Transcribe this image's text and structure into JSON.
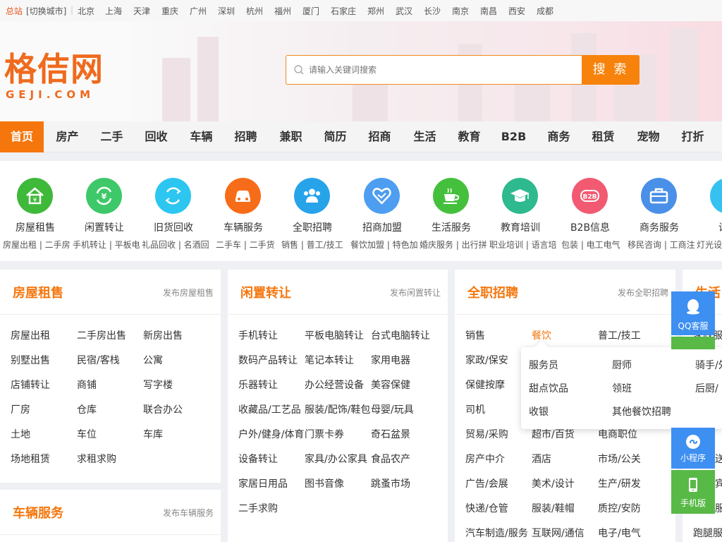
{
  "topbar": {
    "main_site": "总站",
    "switch_city": "[切换城市]",
    "cities": [
      "北京",
      "上海",
      "天津",
      "重庆",
      "广州",
      "深圳",
      "杭州",
      "福州",
      "厦门",
      "石家庄",
      "郑州",
      "武汉",
      "长沙",
      "南京",
      "南昌",
      "西安",
      "成都"
    ]
  },
  "logo": {
    "cn": "格佶网",
    "en": "GEJI.COM"
  },
  "search": {
    "placeholder": "请输入关键词搜索",
    "button": "搜 索"
  },
  "nav": {
    "items": [
      "首页",
      "房产",
      "二手",
      "回收",
      "车辆",
      "招聘",
      "兼职",
      "简历",
      "招商",
      "生活",
      "教育",
      "B2B",
      "商务",
      "租赁",
      "宠物",
      "打折"
    ],
    "active_index": 0
  },
  "categories": [
    {
      "label": "房屋租售",
      "icon": "house-icon",
      "color": "#3fb93a"
    },
    {
      "label": "闲置转让",
      "icon": "exchange-icon",
      "color": "#3ec86a"
    },
    {
      "label": "旧货回收",
      "icon": "recycle-icon",
      "color": "#2cc6f0"
    },
    {
      "label": "车辆服务",
      "icon": "car-icon",
      "color": "#f76c18"
    },
    {
      "label": "全职招聘",
      "icon": "people-icon",
      "color": "#27a3ea"
    },
    {
      "label": "招商加盟",
      "icon": "handshake-icon",
      "color": "#4d9ef0"
    },
    {
      "label": "生活服务",
      "icon": "cup-icon",
      "color": "#45c03d"
    },
    {
      "label": "教育培训",
      "icon": "graduation-cap-icon",
      "color": "#2fb98f"
    },
    {
      "label": "B2B信息",
      "icon": "b2b-icon",
      "color": "#f25a72"
    },
    {
      "label": "商务服务",
      "icon": "briefcase-icon",
      "color": "#4a90e8"
    },
    {
      "label": "设备",
      "icon": "device-icon",
      "color": "#36c2f0"
    }
  ],
  "sublinks": [
    "房屋出租 | 二手房 ",
    "手机转让 | 平板电",
    "礼品回收 | 名酒回",
    "二手车 | 二手货",
    "销售 | 普工/技工",
    "餐饮加盟 | 特色加",
    "婚庆服务 | 出行拼",
    "职业培训 | 语言培",
    "包装 | 电工电气",
    "移民咨询 | 工商注",
    "灯光设"
  ],
  "panels": {
    "house": {
      "title": "房屋租售",
      "publish": "发布房屋租售",
      "links": [
        "房屋出租",
        "二手房出售",
        "新房出售",
        "别墅出售",
        "民宿/客栈",
        "公寓",
        "店铺转让",
        "商铺",
        "写字楼",
        "厂房",
        "仓库",
        "联合办公",
        "土地",
        "车位",
        "车库",
        "场地租赁",
        "求租求购"
      ]
    },
    "car": {
      "title": "车辆服务",
      "publish": "发布车辆服务"
    },
    "idle": {
      "title": "闲置转让",
      "publish": "发布闲置转让",
      "links": [
        "手机转让",
        "平板电脑转让",
        "台式电脑转让",
        "数码产品转让",
        "笔记本转让",
        "家用电器",
        "乐器转让",
        "办公经营设备",
        "美容保健",
        "收藏品/工艺品",
        "服装/配饰/鞋包",
        "母婴/玩具",
        "户外/健身/体育",
        "门票卡券",
        "奇石盆景",
        "设备转让",
        "家具/办公家具",
        "食品农产",
        "家居日用品",
        "图书音像",
        "跳蚤市场",
        "二手求购"
      ]
    },
    "job": {
      "title": "全职招聘",
      "publish": "发布全职招聘",
      "links": [
        "销售",
        "餐饮",
        "普工/技工",
        "家政/保安",
        "保健按摩",
        "司机",
        "贸易/采购",
        "超市/百货",
        "电商职位",
        "房产中介",
        "酒店",
        "市场/公关",
        "广告/会展",
        "美术/设计",
        "生产/研发",
        "快递/仓管",
        "服装/鞋帽",
        "质控/安防",
        "汽车制造/服务",
        "互联网/通信",
        "电子/电气"
      ]
    },
    "life": {
      "title": "生活",
      "links": [
        "家政服",
        "送",
        "宾",
        "服",
        "跑腿服"
      ]
    }
  },
  "dropdown": {
    "items": [
      "服务员",
      "厨师",
      "骑手/外",
      "甜点饮品",
      "领班",
      "后厨/",
      "收银",
      "其他餐饮招聘"
    ]
  },
  "float_bar": {
    "service": "QQ客服",
    "miniapp": "小程序",
    "mobile": "手机版"
  },
  "colors": {
    "accent": "#f5760d",
    "float_blue": "#3d8ff2",
    "float_green": "#58b947"
  }
}
